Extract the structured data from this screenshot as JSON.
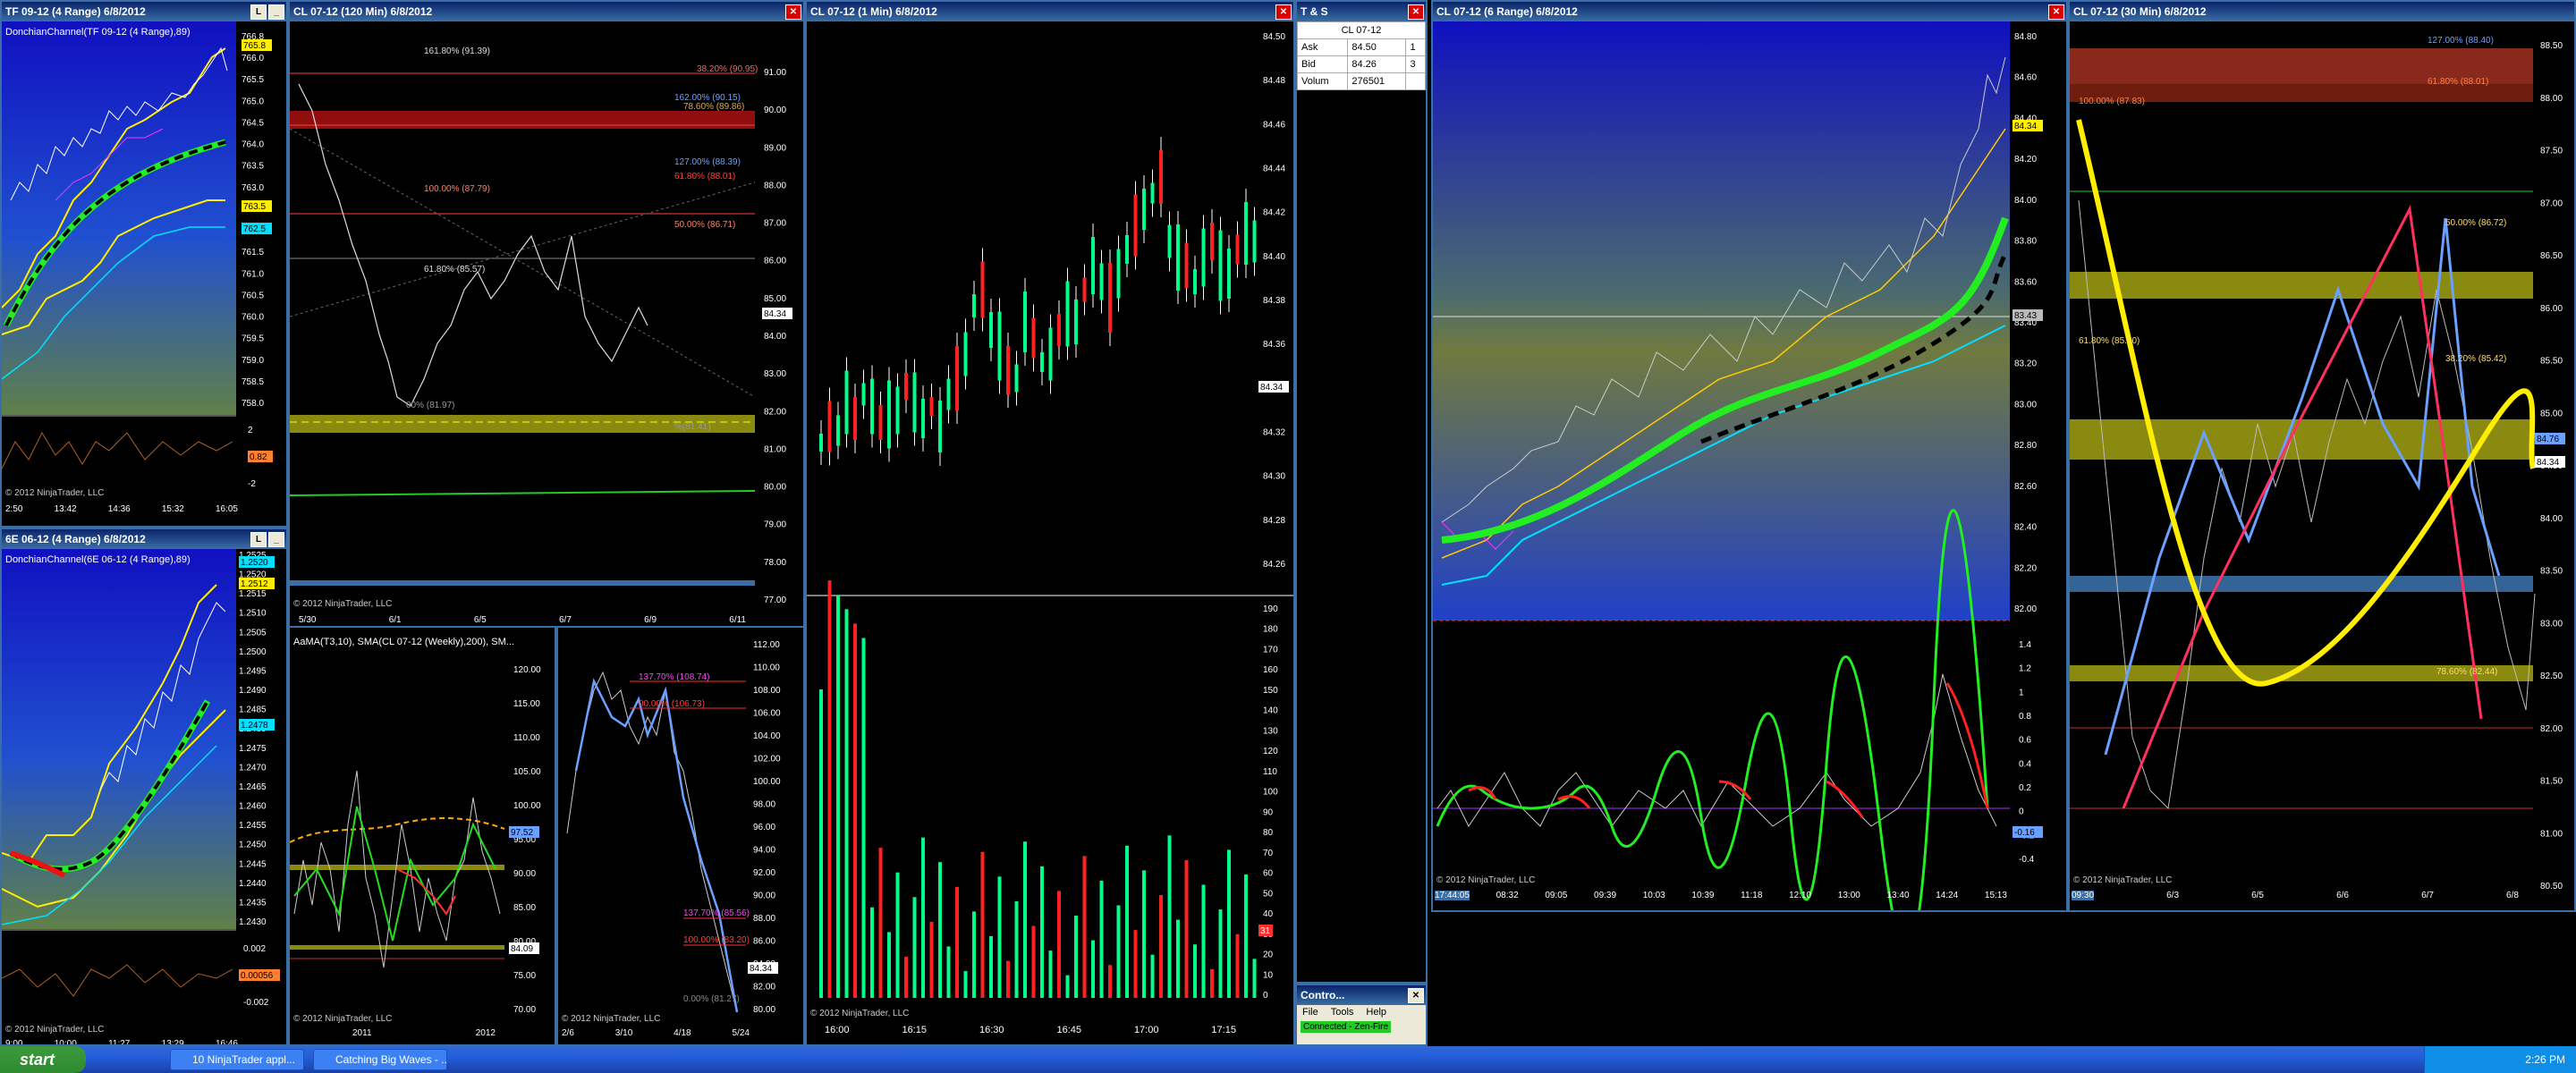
{
  "windows": {
    "tf": {
      "title": "TF 09-12 (4 Range)  6/8/2012",
      "indicator": "DonchianChannel(TF 09-12 (4 Range),89)",
      "price_labels": [
        "766.8",
        "766.0",
        "765.5",
        "765.0",
        "764.5",
        "764.0",
        "763.5",
        "763.0",
        "762.5",
        "762.0",
        "761.5",
        "761.0",
        "760.5",
        "760.0",
        "759.5",
        "759.0",
        "758.5",
        "758.0"
      ],
      "markers": [
        "765.8",
        "763.5",
        "762.5"
      ],
      "osc_labels": [
        "2",
        "0",
        "-2"
      ],
      "osc_marker": "0.82",
      "time_labels": [
        "2:50",
        "13:42",
        "14:36",
        "15:32",
        "16:05"
      ],
      "copyright": "© 2012 NinjaTrader, LLC"
    },
    "eur": {
      "title": "6E 06-12 (4 Range)  6/8/2012",
      "indicator": "DonchianChannel(6E 06-12 (4 Range),89)",
      "price_labels": [
        "1.2525",
        "1.2520",
        "1.2515",
        "1.2510",
        "1.2505",
        "1.2500",
        "1.2495",
        "1.2490",
        "1.2485",
        "1.2480",
        "1.2475",
        "1.2470",
        "1.2465",
        "1.2460",
        "1.2455",
        "1.2450",
        "1.2445",
        "1.2440",
        "1.2435",
        "1.2430"
      ],
      "markers": [
        "1.2520",
        "1.2512",
        "1.2478"
      ],
      "osc_labels": [
        "0.002",
        "0",
        "-0.002"
      ],
      "osc_marker": "0.00056",
      "time_labels": [
        "9:00",
        "10:00",
        "11:27",
        "13:29",
        "16:46"
      ],
      "copyright": "© 2012 NinjaTrader, LLC"
    },
    "cl120": {
      "title": "CL 07-12 (120 Min)  6/8/2012",
      "price_labels": [
        "91.00",
        "90.00",
        "89.00",
        "88.00",
        "87.00",
        "86.00",
        "85.00",
        "84.00",
        "83.00",
        "82.00",
        "81.00",
        "80.00",
        "79.00",
        "78.00",
        "77.00"
      ],
      "fibs": [
        "161.80% (91.39)",
        "38.20% (90.95)",
        "162.00% (90.15)",
        "78.60% (89.86)",
        "127.00% (88.39)",
        "61.80% (88.01)",
        "100.00% (87.79)",
        "50.00% (86.71)",
        "61.80% (85.57)",
        "00% (81.97)",
        "%(81.41)"
      ],
      "marker": "84.34",
      "time_labels": [
        "5/30",
        "6/1",
        "6/5",
        "6/7",
        "6/9",
        "6/11"
      ],
      "copyright": "© 2012 NinjaTrader, LLC"
    },
    "cl1": {
      "title": "CL 07-12 (1 Min)  6/8/2012",
      "price_labels": [
        "84.50",
        "84.48",
        "84.46",
        "84.44",
        "84.42",
        "84.40",
        "84.38",
        "84.36",
        "84.34",
        "84.32",
        "84.30",
        "84.28",
        "84.26"
      ],
      "marker": "84.34",
      "vol_labels": [
        "190",
        "180",
        "170",
        "160",
        "150",
        "140",
        "130",
        "120",
        "110",
        "100",
        "90",
        "80",
        "70",
        "60",
        "50",
        "40",
        "30",
        "20",
        "10",
        "0"
      ],
      "vol_marker": "31",
      "time_labels": [
        "16:00",
        "16:15",
        "16:30",
        "16:45",
        "17:00",
        "17:15"
      ],
      "copyright": "© 2012 NinjaTrader, LLC"
    },
    "quote": {
      "title": "T & S",
      "instrument": "CL 07-12",
      "rows": [
        {
          "k": "Ask",
          "v": "84.50",
          "s": "1"
        },
        {
          "k": "Bid",
          "v": "84.26",
          "s": "3"
        },
        {
          "k": "Volum",
          "v": "276501",
          "s": ""
        }
      ]
    },
    "amma": {
      "indicator": "AaMA(T3,10), SMA(CL 07-12 (Weekly),200), SM...",
      "price_labels": [
        "120.00",
        "115.00",
        "110.00",
        "105.00",
        "100.00",
        "95.00",
        "90.00",
        "85.00",
        "80.00",
        "75.00",
        "70.00"
      ],
      "markers": [
        "97.52",
        "84.09"
      ],
      "time_labels": [
        "2011",
        "2012"
      ],
      "copyright": "© 2012 NinjaTrader, LLC"
    },
    "wave": {
      "price_labels": [
        "112.00",
        "110.00",
        "108.00",
        "106.00",
        "104.00",
        "102.00",
        "100.00",
        "98.00",
        "96.00",
        "94.00",
        "92.00",
        "90.00",
        "88.00",
        "86.00",
        "84.00",
        "82.00",
        "80.00"
      ],
      "fibs": [
        "137.70% (108.74)",
        "00.00% (106.73)",
        "137.70% (85.56)",
        "100.00% (83.20)",
        "0.00% (81.27)"
      ],
      "marker": "84.34",
      "time_labels": [
        "2/6",
        "3/10",
        "4/18",
        "5/24"
      ],
      "copyright": "© 2012 NinjaTrader, LLC"
    },
    "control": {
      "title": "Contro...",
      "menu": [
        "File",
        "Tools",
        "Help"
      ],
      "status": "Connected - Zen-Fire"
    },
    "cl6r": {
      "title": "CL 07-12 (6 Range)  6/8/2012",
      "price_labels": [
        "84.80",
        "84.60",
        "84.40",
        "84.20",
        "84.00",
        "83.80",
        "83.60",
        "83.40",
        "83.20",
        "83.00",
        "82.80",
        "82.60",
        "82.40",
        "82.20",
        "82.00"
      ],
      "markers": [
        "84.34",
        "83.43"
      ],
      "osc_labels": [
        "1.4",
        "1.2",
        "1",
        "0.8",
        "0.6",
        "0.4",
        "0.2",
        "0",
        "-0.2",
        "-0.4"
      ],
      "osc_marker": "-0.16",
      "time_labels": [
        "17:44:05",
        "08:32",
        "09:05",
        "09:39",
        "10:03",
        "10:39",
        "11:18",
        "12:10",
        "13:00",
        "13:40",
        "14:24",
        "15:13"
      ],
      "copyright": "© 2012 NinjaTrader, LLC"
    },
    "cl30": {
      "title": "CL 07-12 (30 Min)  6/8/2012",
      "price_labels": [
        "88.50",
        "88.00",
        "87.50",
        "87.00",
        "86.50",
        "86.00",
        "85.50",
        "85.00",
        "84.50",
        "84.00",
        "83.50",
        "83.00",
        "82.50",
        "82.00",
        "81.50",
        "81.00",
        "80.50"
      ],
      "fibs": [
        "127.00% (88.40)",
        "61.80% (88.01)",
        "100.00% (87.83)",
        "50.00% (86.72)",
        "61.80% (85.60)",
        "38.20% (85.42)",
        "78.60% (82.44)"
      ],
      "markers": [
        "84.76",
        "84.34"
      ],
      "time_labels": [
        "09:30",
        "6/3",
        "6/5",
        "6/6",
        "6/7",
        "6/8"
      ],
      "copyright": "© 2012 NinjaTrader, LLC"
    }
  },
  "taskbar": {
    "start": "start",
    "tasks": [
      "10 NinjaTrader appl...",
      "Catching Big Waves - ..."
    ],
    "clock": "2:26 PM"
  },
  "colors": {
    "titlebar": "#0a246a",
    "accent": "#3a6ea5",
    "bull": "#00ff88",
    "bear": "#ff2020",
    "fib_zone_red": "#a01010",
    "fib_zone_yellow": "#8a8a10"
  }
}
